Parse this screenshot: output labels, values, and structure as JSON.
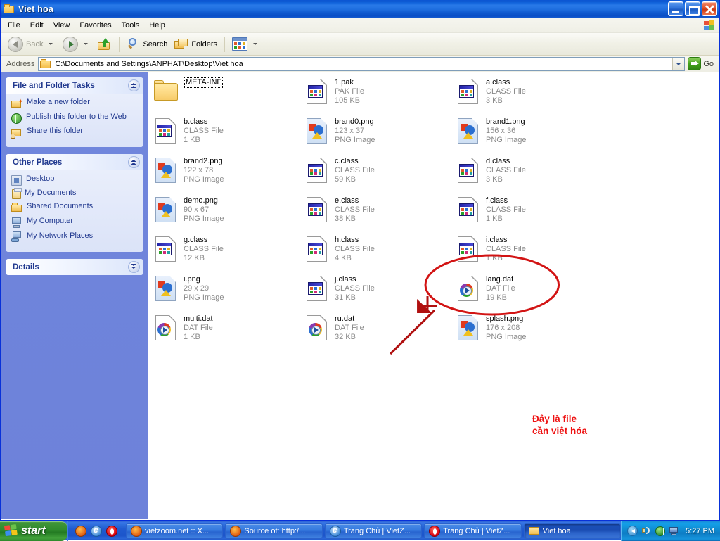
{
  "window": {
    "title": "Viet hoa",
    "icon": "folder-icon",
    "controls": {
      "minimize": "Minimize",
      "restore": "Restore",
      "close": "Close"
    }
  },
  "menubar": {
    "items": [
      {
        "label": "File"
      },
      {
        "label": "Edit"
      },
      {
        "label": "View"
      },
      {
        "label": "Favorites"
      },
      {
        "label": "Tools"
      },
      {
        "label": "Help"
      }
    ]
  },
  "toolbar": {
    "back_label": "Back",
    "forward_label": "",
    "up_label": "",
    "search_label": "Search",
    "folders_label": "Folders",
    "views_label": ""
  },
  "address": {
    "label": "Address",
    "value": "C:\\Documents and Settings\\ANPHAT\\Desktop\\Viet hoa",
    "go_label": "Go"
  },
  "sidebar": {
    "panels": [
      {
        "title": "File and Folder Tasks",
        "collapsed": false,
        "chevron": "chevron-up-icon",
        "links": [
          {
            "label": "Make a new folder",
            "icon": "new-folder-icon"
          },
          {
            "label": "Publish this folder to the Web",
            "icon": "globe-icon"
          },
          {
            "label": "Share this folder",
            "icon": "share-folder-icon"
          }
        ]
      },
      {
        "title": "Other Places",
        "collapsed": false,
        "chevron": "chevron-up-icon",
        "links": [
          {
            "label": "Desktop",
            "icon": "desktop-icon"
          },
          {
            "label": "My Documents",
            "icon": "my-documents-icon"
          },
          {
            "label": "Shared Documents",
            "icon": "shared-documents-icon"
          },
          {
            "label": "My Computer",
            "icon": "my-computer-icon"
          },
          {
            "label": "My Network Places",
            "icon": "my-network-places-icon"
          }
        ]
      },
      {
        "title": "Details",
        "collapsed": true,
        "chevron": "chevron-down-icon",
        "links": []
      }
    ]
  },
  "files": {
    "columns": [
      [
        {
          "name": "META-INF",
          "line2": "",
          "line3": "",
          "kind": "folder",
          "focused": true
        },
        {
          "name": "b.class",
          "line2": "CLASS File",
          "line3": "1 KB",
          "kind": "class"
        },
        {
          "name": "brand2.png",
          "line2": "122 x 78",
          "line3": "PNG Image",
          "kind": "png"
        },
        {
          "name": "demo.png",
          "line2": "90 x 67",
          "line3": "PNG Image",
          "kind": "png"
        },
        {
          "name": "g.class",
          "line2": "CLASS File",
          "line3": "12 KB",
          "kind": "class"
        },
        {
          "name": "i.png",
          "line2": "29 x 29",
          "line3": "PNG Image",
          "kind": "png"
        },
        {
          "name": "multi.dat",
          "line2": "DAT File",
          "line3": "1 KB",
          "kind": "dat"
        }
      ],
      [
        {
          "name": "1.pak",
          "line2": "PAK File",
          "line3": "105 KB",
          "kind": "class"
        },
        {
          "name": "brand0.png",
          "line2": "123 x 37",
          "line3": "PNG Image",
          "kind": "png"
        },
        {
          "name": "c.class",
          "line2": "CLASS File",
          "line3": "59 KB",
          "kind": "class"
        },
        {
          "name": "e.class",
          "line2": "CLASS File",
          "line3": "38 KB",
          "kind": "class"
        },
        {
          "name": "h.class",
          "line2": "CLASS File",
          "line3": "4 KB",
          "kind": "class"
        },
        {
          "name": "j.class",
          "line2": "CLASS File",
          "line3": "31 KB",
          "kind": "class"
        },
        {
          "name": "ru.dat",
          "line2": "DAT File",
          "line3": "32 KB",
          "kind": "dat"
        }
      ],
      [
        {
          "name": "a.class",
          "line2": "CLASS File",
          "line3": "3 KB",
          "kind": "class"
        },
        {
          "name": "brand1.png",
          "line2": "156 x 36",
          "line3": "PNG Image",
          "kind": "png"
        },
        {
          "name": "d.class",
          "line2": "CLASS File",
          "line3": "3 KB",
          "kind": "class"
        },
        {
          "name": "f.class",
          "line2": "CLASS File",
          "line3": "1 KB",
          "kind": "class"
        },
        {
          "name": "i.class",
          "line2": "CLASS File",
          "line3": "1 KB",
          "kind": "class"
        },
        {
          "name": "lang.dat",
          "line2": "DAT File",
          "line3": "19 KB",
          "kind": "dat"
        },
        {
          "name": "splash.png",
          "line2": "176 x 208",
          "line3": "PNG Image",
          "kind": "png"
        }
      ]
    ]
  },
  "annotation": {
    "text_line1": "Đây là file",
    "text_line2": "cần việt hóa",
    "color": "#ee1111",
    "target": "lang.dat"
  },
  "taskbar": {
    "start_label": "start",
    "quicklaunch": [
      {
        "icon": "firefox-icon"
      },
      {
        "icon": "ie-icon"
      },
      {
        "icon": "opera-icon"
      }
    ],
    "tasks": [
      {
        "label": "vietzoom.net :: X...",
        "icon": "firefox-icon",
        "active": false
      },
      {
        "label": "Source of: http:/...",
        "icon": "firefox-icon",
        "active": false
      },
      {
        "label": "Trang Chủ | VietZ...",
        "icon": "ie-icon",
        "active": false
      },
      {
        "label": "Trang Chủ | VietZ...",
        "icon": "opera-icon",
        "active": false
      },
      {
        "label": "Viet hoa",
        "icon": "folder-icon",
        "active": true
      }
    ],
    "tray": {
      "chevron": "show-hidden-icons",
      "icons": [
        "speaker-icon",
        "network-globe-icon",
        "monitor-icon"
      ],
      "clock": "5:27 PM"
    }
  },
  "colors": {
    "titlebar_blue": "#1f6fe0",
    "sidebar_blue": "#6f84db",
    "panel_header_text": "#21398f",
    "annotation_red": "#ee1111",
    "taskbar_blue": "#205bd0",
    "start_green": "#2f8a2c"
  }
}
